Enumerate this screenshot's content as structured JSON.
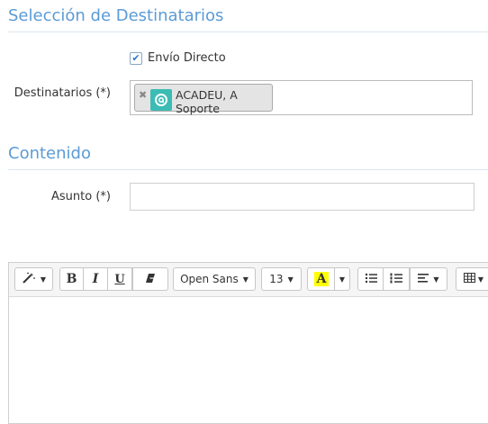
{
  "sections": {
    "recipients_title": "Selección de Destinatarios",
    "content_title": "Contenido"
  },
  "direct_send": {
    "label": "Envío Directo",
    "checked": true
  },
  "recipients": {
    "label": "Destinatarios (*)",
    "chips": [
      {
        "label": "ACADEU, A Soporte",
        "avatar_color": "#3cbcb4"
      }
    ]
  },
  "subject": {
    "label": "Asunto (*)",
    "value": ""
  },
  "toolbar": {
    "font_family": "Open Sans",
    "font_size": "13",
    "highlight_letter": "A",
    "bold": "B",
    "italic": "I",
    "underline": "U"
  },
  "colors": {
    "accent": "#5b9bd5",
    "highlight": "#ffff00",
    "checkbox": "#2e78c7"
  }
}
